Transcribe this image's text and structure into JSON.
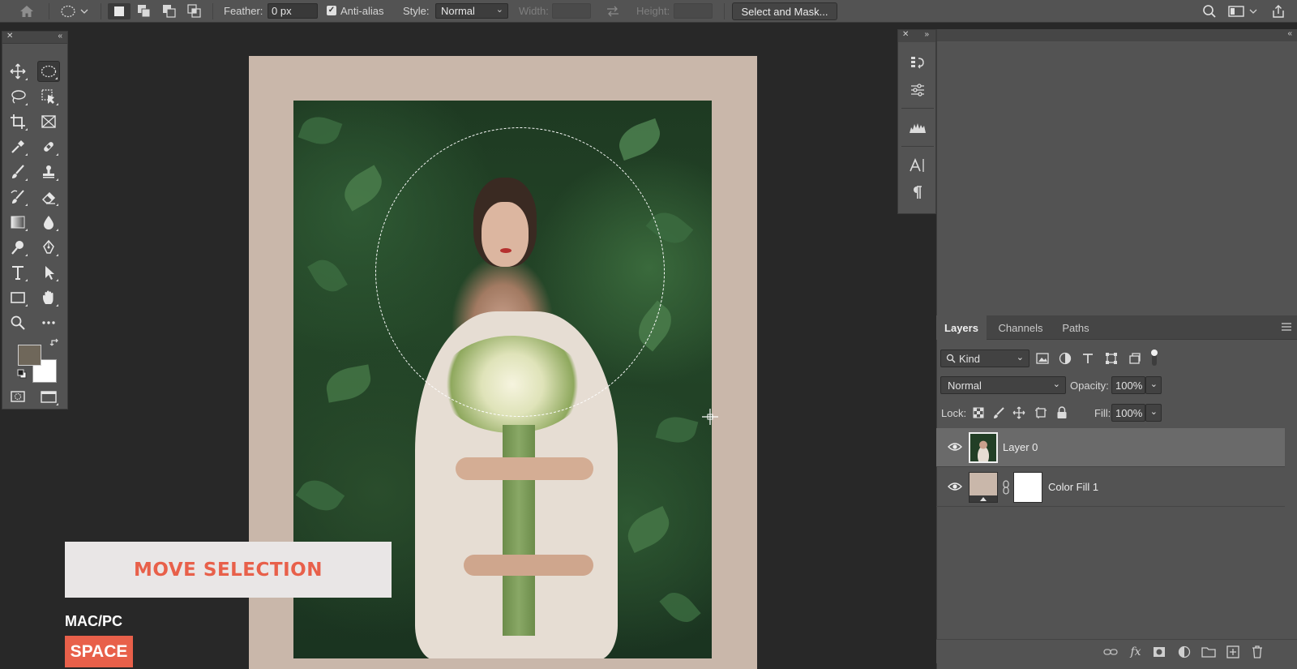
{
  "options_bar": {
    "feather_label": "Feather:",
    "feather_value": "0 px",
    "antialias_label": "Anti-alias",
    "antialias_checked": true,
    "style_label": "Style:",
    "style_value": "Normal",
    "width_label": "Width:",
    "height_label": "Height:",
    "select_mask_label": "Select and Mask..."
  },
  "tools": {
    "active": "elliptical-marquee-tool",
    "foreground_color": "#6f675a",
    "background_color": "#ffffff"
  },
  "caption": {
    "title": "MOVE SELECTION",
    "platform": "MAC/PC",
    "key": "SPACE"
  },
  "layers_panel": {
    "tabs": [
      "Layers",
      "Channels",
      "Paths"
    ],
    "active_tab": "Layers",
    "filter_value": "Kind",
    "blend_mode": "Normal",
    "opacity_label": "Opacity:",
    "opacity_value": "100%",
    "lock_label": "Lock:",
    "fill_label": "Fill:",
    "fill_value": "100%",
    "layers": [
      {
        "name": "Layer 0",
        "visible": true,
        "selected": true
      },
      {
        "name": "Color Fill 1",
        "visible": true,
        "selected": false
      }
    ]
  },
  "colors": {
    "accent": "#e8604a",
    "canvas_fill": "#c9b7aa",
    "panel": "#535353"
  }
}
